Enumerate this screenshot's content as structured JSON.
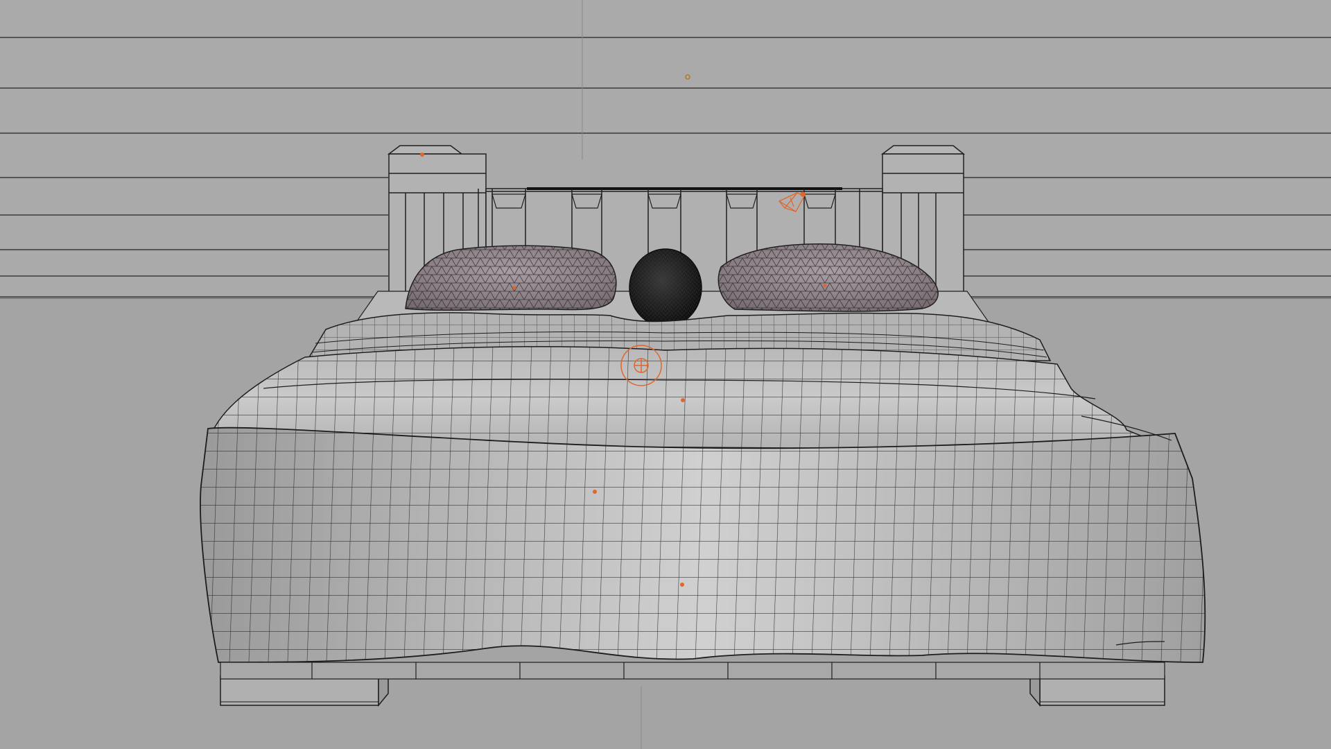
{
  "viewport": {
    "mode": "wireframe-on-shaded",
    "colors": {
      "background": "#a7a7a7",
      "wall": "#a9a9a9",
      "floor": "#a4a4a4",
      "wire": "#1c1c1c",
      "blanket": "#c2c2c2",
      "pillow": "#8e8589",
      "head": "#1a1a1a",
      "selection": "#e0662a"
    }
  },
  "scene": {
    "objects": [
      {
        "name": "wall"
      },
      {
        "name": "floor"
      },
      {
        "name": "headboard"
      },
      {
        "name": "pillow-left"
      },
      {
        "name": "pillow-right"
      },
      {
        "name": "head"
      },
      {
        "name": "blanket"
      },
      {
        "name": "bed-legs"
      }
    ]
  }
}
